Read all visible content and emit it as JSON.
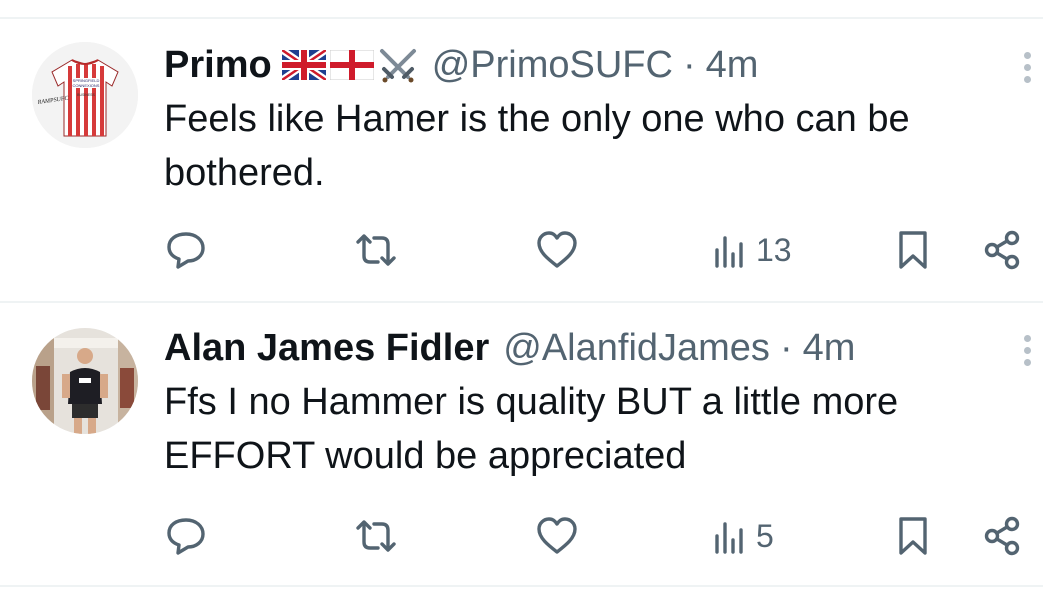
{
  "tweets": [
    {
      "name": "Primo",
      "flag_icons": [
        "uk-flag",
        "england-flag",
        "crossed-swords"
      ],
      "handle": "@PrimoSUFC",
      "separator": "·",
      "time": "4m",
      "text": "Feels like Hamer is the only one who can be bothered.",
      "avatar": "jersey-avatar",
      "avatar_text": [
        "SPRINGFIELD",
        "CONNEXIONS",
        "BUSINESS",
        "RAMPSUFC"
      ],
      "views": "13"
    },
    {
      "name": "Alan James Fidler",
      "flag_icons": [],
      "handle": "@AlanfidJames",
      "separator": "·",
      "time": "4m",
      "text": "Ffs I no Hammer is quality BUT a little more EFFORT would be appreciated",
      "avatar": "person-photo-avatar",
      "views": "5"
    }
  ],
  "colors": {
    "text": "#0f1419",
    "secondary": "#536471",
    "divider": "#eff3f4"
  }
}
